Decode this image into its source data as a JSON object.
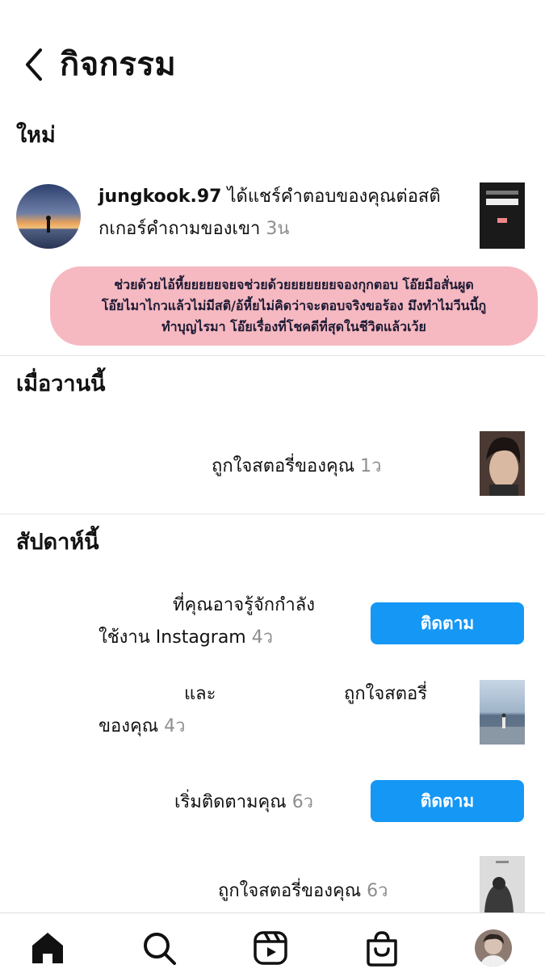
{
  "header": {
    "title": "กิจกรรม",
    "back_icon": "chevron-left-icon"
  },
  "sections": {
    "new": "ใหม่",
    "yesterday": "เมื่อวานนี้",
    "this_week": "สัปดาห์นี้"
  },
  "notifications": {
    "n1": {
      "username": "jungkook.97",
      "line1_rest": " ได้แชร์คำตอบของคุณต่อสติ",
      "line2": "กเกอร์คำถามของเขา ",
      "time": "3น"
    },
    "n2": {
      "text": "ถูกใจสตอรี่ของคุณ ",
      "time": "1ว"
    },
    "n3": {
      "line1": "ที่คุณอาจรู้จักกำลัง",
      "line2": "ใช้งาน Instagram ",
      "time": "4ว",
      "button": "ติดตาม"
    },
    "n4": {
      "and": "และ",
      "liked": "ถูกใจสตอรี่",
      "line2": "ของคุณ ",
      "time": "4ว"
    },
    "n5": {
      "text": "เริ่มติดตามคุณ ",
      "time": "6ว",
      "button": "ติดตาม"
    },
    "n6": {
      "text": "ถูกใจสตอรี่ของคุณ ",
      "time": "6ว"
    }
  },
  "overlay": {
    "line1": "ช่วยด้วยไอ้หี้ยยยยยจยจช่วยด้วยยยยยยยจองกุกตอบ โอ๊ยมือสั่นผูด",
    "line2": "โอ๊ยไมาไกวแล้วไม่มีสติ/อ้หี้ยไม่คิดว่าจะตอบจริงขอร้อง มึงทำไมวีนนี้กู",
    "line3": "ทำบุญไรมา โอ๊ยเรื่องที่โชคดีที่สุดในชีวิตแล้วเว้ย"
  },
  "tabbar": [
    "home-icon",
    "search-icon",
    "reels-icon",
    "shop-icon",
    "profile-avatar"
  ],
  "colors": {
    "follow_button": "#1597f5",
    "overlay": "#f6b9c1",
    "timestamp": "#8e8e8e"
  }
}
